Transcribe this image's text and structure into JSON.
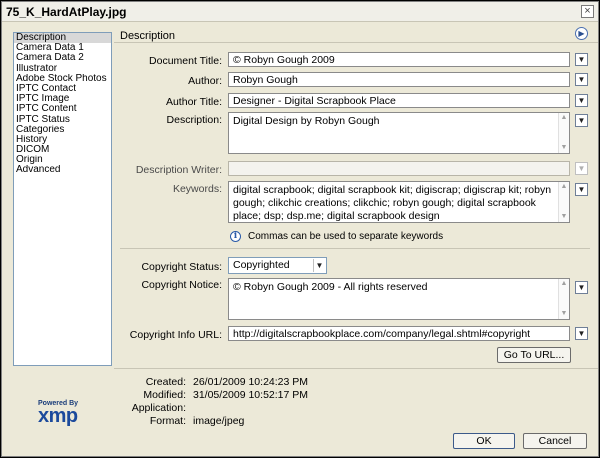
{
  "window": {
    "title": "75_K_HardAtPlay.jpg",
    "close_glyph": "×"
  },
  "sidebar": {
    "items": [
      {
        "label": "Description",
        "selected": true
      },
      {
        "label": "Camera Data 1"
      },
      {
        "label": "Camera Data 2"
      },
      {
        "label": "Illustrator"
      },
      {
        "label": "Adobe Stock Photos"
      },
      {
        "label": "IPTC Contact"
      },
      {
        "label": "IPTC Image"
      },
      {
        "label": "IPTC Content"
      },
      {
        "label": "IPTC Status"
      },
      {
        "label": "Categories"
      },
      {
        "label": "History"
      },
      {
        "label": "DICOM"
      },
      {
        "label": "Origin"
      },
      {
        "label": "Advanced"
      }
    ]
  },
  "panel": {
    "title": "Description",
    "fields": {
      "document_title": {
        "label": "Document Title:",
        "value": "© Robyn Gough 2009"
      },
      "author": {
        "label": "Author:",
        "value": "Robyn Gough"
      },
      "author_title": {
        "label": "Author Title:",
        "value": "Designer - Digital Scrapbook Place"
      },
      "description": {
        "label": "Description:",
        "value": "Digital Design by Robyn Gough"
      },
      "description_writer": {
        "label": "Description Writer:",
        "value": ""
      },
      "keywords": {
        "label": "Keywords:",
        "value": "digital scrapbook; digital scrapbook kit; digiscrap; digiscrap kit; robyn gough; clikchic creations; clikchic; robyn gough; digital scrapbook place; dsp; dsp.me; digital scrapbook design"
      },
      "copyright_status": {
        "label": "Copyright Status:",
        "value": "Copyrighted"
      },
      "copyright_notice": {
        "label": "Copyright Notice:",
        "value": "© Robyn Gough 2009 - All rights reserved"
      },
      "copyright_url": {
        "label": "Copyright Info URL:",
        "value": "http://digitalscrapbookplace.com/company/legal.shtml#copyright"
      }
    },
    "hint": "Commas can be used to separate keywords",
    "goto_url_label": "Go To URL..."
  },
  "meta": {
    "created": {
      "label": "Created:",
      "value": "26/01/2009 10:24:23 PM"
    },
    "modified": {
      "label": "Modified:",
      "value": "31/05/2009 10:52:17 PM"
    },
    "application": {
      "label": "Application:",
      "value": ""
    },
    "format": {
      "label": "Format:",
      "value": "image/jpeg"
    }
  },
  "logo": {
    "powered_by": "Powered By",
    "brand": "xmp"
  },
  "buttons": {
    "ok": "OK",
    "cancel": "Cancel"
  },
  "glyphs": {
    "dropdown": "▼",
    "scroll_up": "▲",
    "scroll_down": "▼",
    "info": "i",
    "nav": "▶"
  },
  "colors": {
    "dialog_bg": "#ece9d8",
    "accent": "#1c4a9c"
  }
}
